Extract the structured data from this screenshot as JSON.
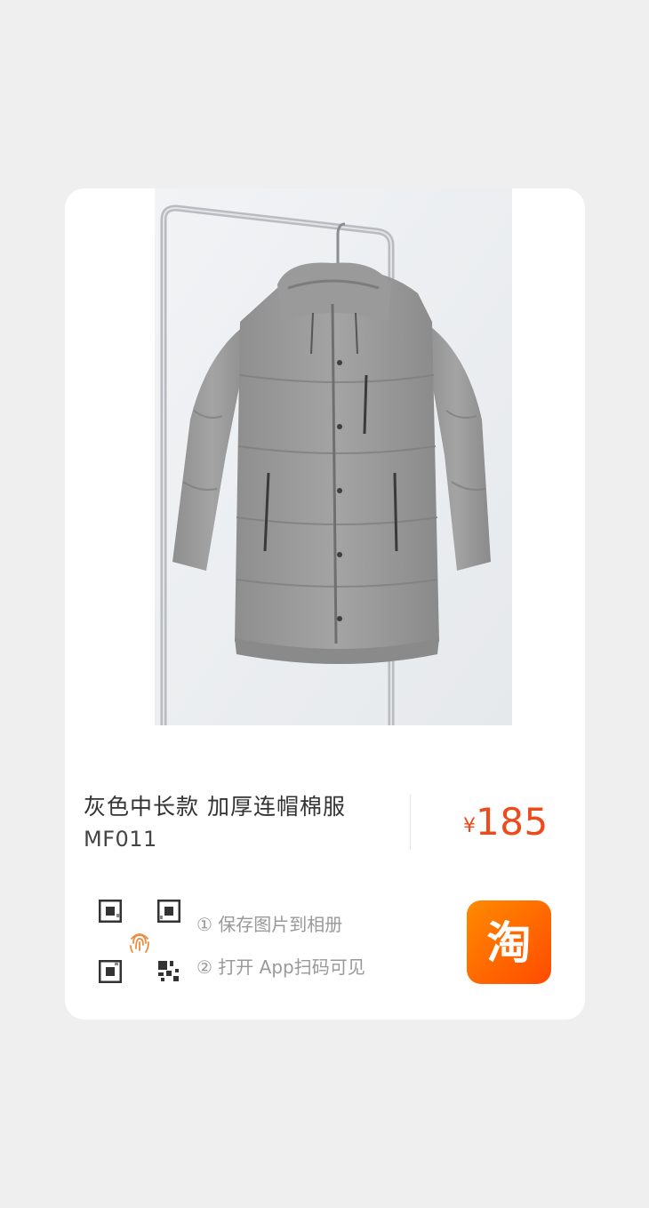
{
  "product": {
    "title": "灰色中长款 加厚连帽棉服",
    "sku": "MF011",
    "currency": "¥",
    "price": "185"
  },
  "instructions": {
    "step1": "① 保存图片到相册",
    "step2": "② 打开 App扫码可见"
  },
  "logo": {
    "text": "淘",
    "colors": [
      "#ff8a00",
      "#ff4b00"
    ]
  },
  "colors": {
    "price": "#ee4a1a",
    "fingerprint": "#f08a3c"
  }
}
